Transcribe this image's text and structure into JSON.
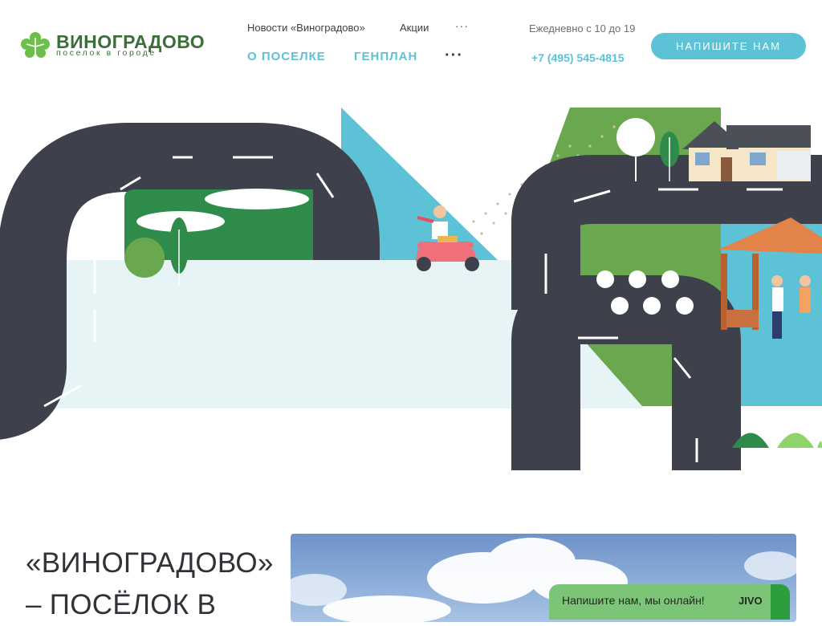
{
  "brand": {
    "name": "ВИНОГРАДОВО",
    "tagline": "поселок в городе",
    "color": "#3c6e3a"
  },
  "top_nav": {
    "items": [
      {
        "label": "Новости «Виноградово»"
      },
      {
        "label": "Акции"
      }
    ],
    "more": "···"
  },
  "main_nav": {
    "items": [
      {
        "label": "О ПОСЕЛКЕ"
      },
      {
        "label": "ГЕНПЛАН"
      }
    ],
    "more": "···"
  },
  "contact": {
    "hours": "Ежедневно с 10 до 19",
    "phone": "+7 (495) 545-4815"
  },
  "cta": {
    "label": "НАПИШИТЕ НАМ",
    "color": "#5ec2d6"
  },
  "headline": {
    "line1": "«ВИНОГРАДОВО»",
    "line2": "– ПОСЁЛОК В"
  },
  "chat_widget": {
    "text": "Напишите нам, мы онлайн!",
    "brand": "JIVO"
  },
  "colors": {
    "accent": "#5ec2d6",
    "road": "#3e414b",
    "green": "#2e8b4a",
    "light_green": "#6aa84f"
  }
}
